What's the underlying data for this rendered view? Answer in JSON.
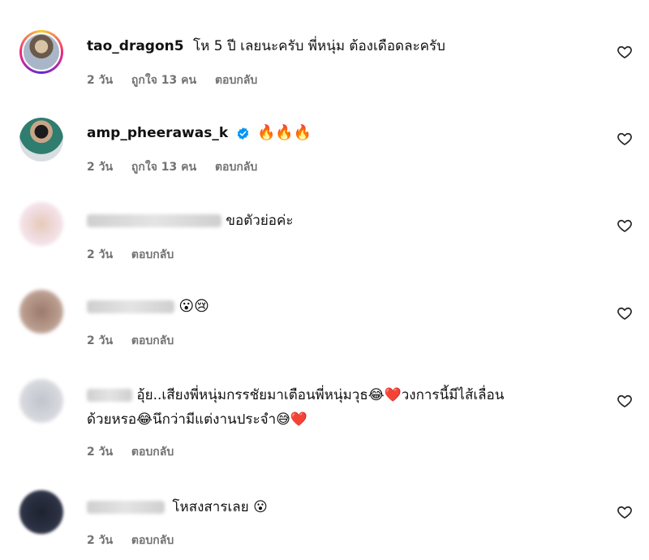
{
  "comments": [
    {
      "username": "tao_dragon5",
      "text": "โห 5 ปี เลยนะครับ พี่หนุ่ม ต้องเดือดละครับ",
      "time": "2 วัน",
      "likes": "ถูกใจ 13 คน",
      "reply": "ตอบกลับ"
    },
    {
      "username": "amp_pheerawas_k",
      "verified": true,
      "text": "🔥🔥🔥",
      "time": "2 วัน",
      "likes": "ถูกใจ 13 คน",
      "reply": "ตอบกลับ"
    },
    {
      "username_hidden": true,
      "text": "ขอตัวย่อค่ะ",
      "time": "2 วัน",
      "reply": "ตอบกลับ"
    },
    {
      "username_hidden": true,
      "text": "😮😢",
      "time": "2 วัน",
      "reply": "ตอบกลับ"
    },
    {
      "username_hidden": true,
      "text_line1": "อุ้ย..เสียงพี่หนุ่มกรรชัยมาเตือนพี่หนุ่มวุธ😂❤️วงการนี้มีไส้เลื่อน",
      "text_line2": "ด้วยหรอ😂นึกว่ามีแต่งานประจำ😅❤️",
      "time": "2 วัน",
      "reply": "ตอบกลับ"
    },
    {
      "username_hidden": true,
      "text": "โหสงสารเลย 😮",
      "time": "2 วัน",
      "reply": "ตอบกลับ"
    }
  ],
  "icons": {
    "heart": "heart-outline-icon",
    "verified": "verified-badge-icon"
  },
  "colors": {
    "meta_text": "#737373",
    "verified_blue": "#0095f6"
  }
}
